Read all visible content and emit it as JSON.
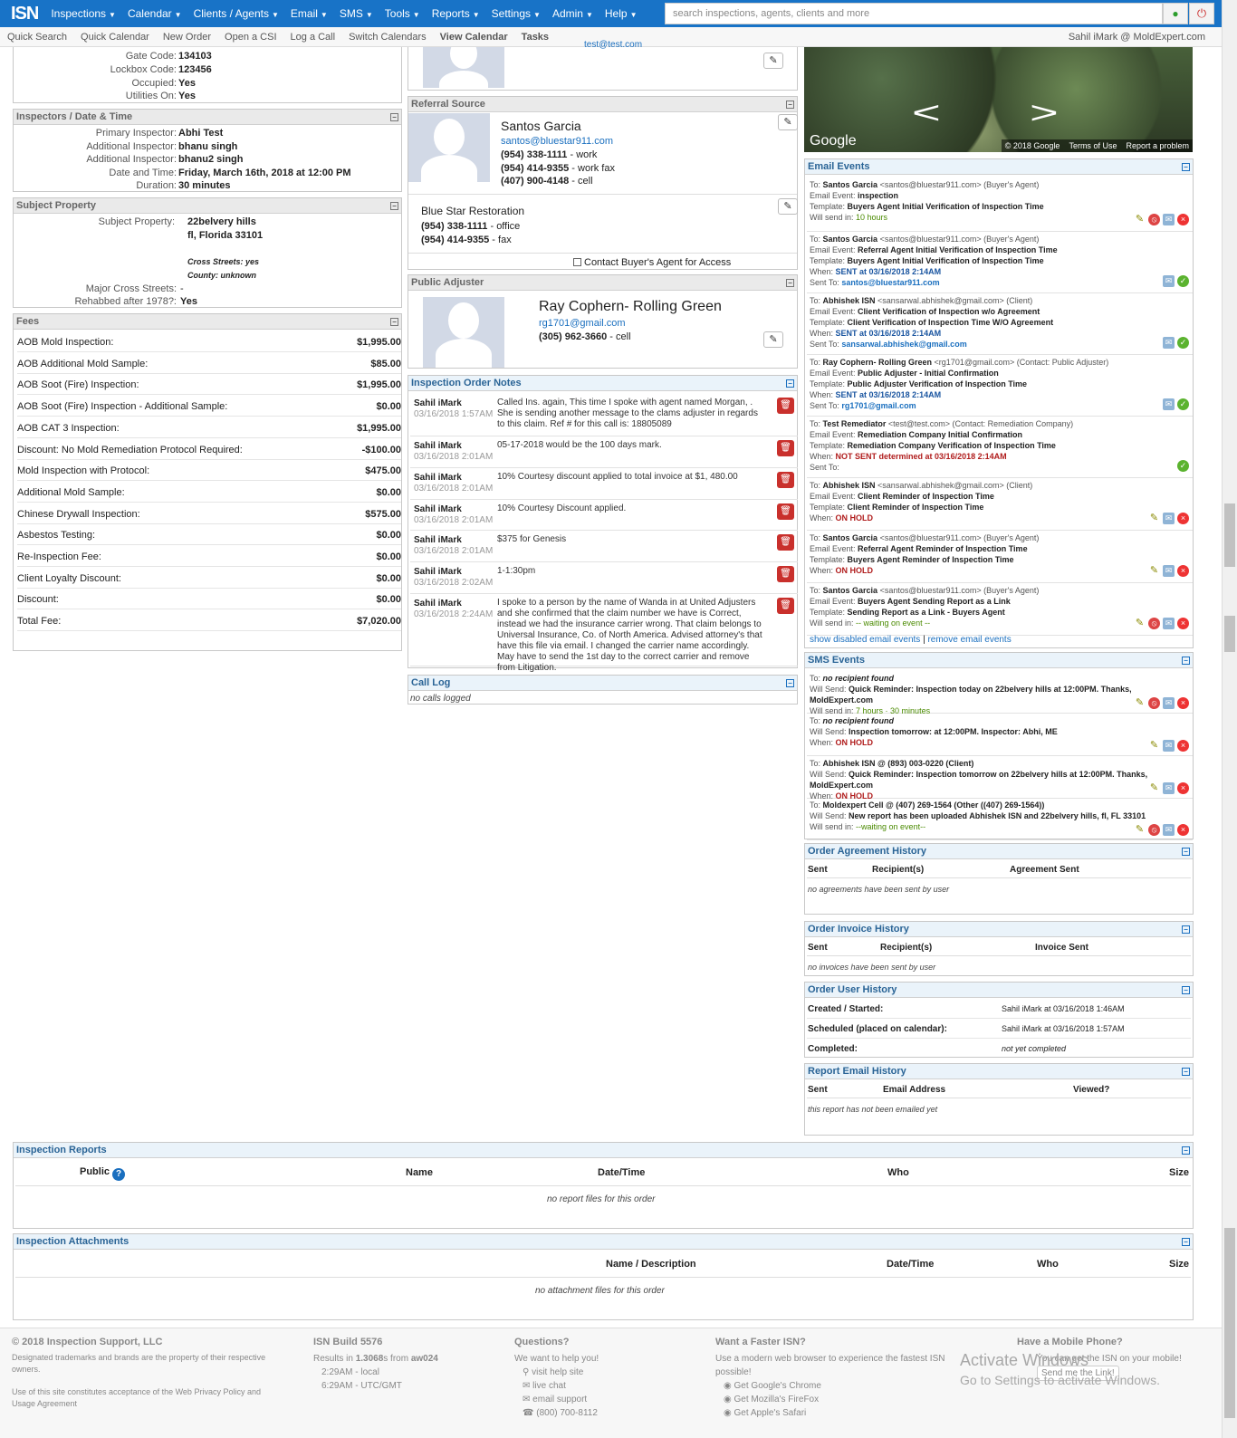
{
  "app": {
    "logo": "ISN"
  },
  "nav": {
    "items": [
      "Inspections",
      "Calendar",
      "Clients / Agents",
      "Email",
      "SMS",
      "Tools",
      "Reports",
      "Settings",
      "Admin",
      "Help"
    ],
    "search_placeholder": "search inspections, agents, clients and more"
  },
  "subnav": {
    "items": [
      "Quick Search",
      "Quick Calendar",
      "New Order",
      "Open a CSI",
      "Log a Call",
      "Switch Calendars",
      "View Calendar",
      "Tasks"
    ],
    "user": "Sahil iMark @ MoldExpert.com"
  },
  "property_top": [
    {
      "label": "Gate Code:",
      "value": "134103"
    },
    {
      "label": "Lockbox Code:",
      "value": "123456"
    },
    {
      "label": "Occupied:",
      "value": "Yes"
    },
    {
      "label": "Utilities On:",
      "value": "Yes"
    }
  ],
  "inspectors": {
    "title": "Inspectors / Date & Time",
    "rows": [
      {
        "label": "Primary Inspector:",
        "value": "Abhi Test"
      },
      {
        "label": "Additional Inspector:",
        "value": "bhanu singh"
      },
      {
        "label": "Additional Inspector:",
        "value": "bhanu2 singh"
      },
      {
        "label": "Date and Time:",
        "value": "Friday, March 16th, 2018 at 12:00 PM"
      },
      {
        "label": "Duration:",
        "value": "30 minutes"
      }
    ]
  },
  "subject": {
    "title": "Subject Property",
    "label": "Subject Property:",
    "line1": "22belvery hills",
    "line2": "fl, Florida 33101",
    "cross": "Cross Streets: yes",
    "county": "County: unknown",
    "major_label": "Major Cross Streets:",
    "major_value": "-",
    "rehab_label": "Rehabbed after 1978?:",
    "rehab_value": "Yes"
  },
  "fees": {
    "title": "Fees",
    "rows": [
      {
        "label": "AOB Mold Inspection:",
        "amount": "$1,995.00"
      },
      {
        "label": "AOB Additional Mold Sample:",
        "amount": "$85.00"
      },
      {
        "label": "AOB Soot (Fire) Inspection:",
        "amount": "$1,995.00"
      },
      {
        "label": "AOB Soot (Fire) Inspection - Additional Sample:",
        "amount": "$0.00"
      },
      {
        "label": "AOB CAT 3 Inspection:",
        "amount": "$1,995.00"
      },
      {
        "label": "Discount: No Mold Remediation Protocol Required:",
        "amount": "-$100.00"
      },
      {
        "label": "Mold Inspection with Protocol:",
        "amount": "$475.00"
      },
      {
        "label": "Additional Mold Sample:",
        "amount": "$0.00"
      },
      {
        "label": "Chinese Drywall Inspection:",
        "amount": "$575.00"
      },
      {
        "label": "Asbestos Testing:",
        "amount": "$0.00"
      },
      {
        "label": "Re-Inspection Fee:",
        "amount": "$0.00"
      },
      {
        "label": "Client Loyalty Discount:",
        "amount": "$0.00"
      },
      {
        "label": "Discount:",
        "amount": "$0.00"
      },
      {
        "label": "Total Fee:",
        "amount": "$7,020.00"
      }
    ]
  },
  "top_contact": {
    "email": "test@test.com"
  },
  "referral": {
    "title": "Referral Source",
    "name": "Santos Garcia",
    "email": "santos@bluestar911.com",
    "phones": [
      {
        "num": "(954) 338-1111",
        "type": "- work"
      },
      {
        "num": "(954) 414-9355",
        "type": "- work fax"
      },
      {
        "num": "(407) 900-4148",
        "type": "- cell"
      }
    ],
    "company": "Blue Star Restoration",
    "cphones": [
      {
        "num": "(954) 338-1111",
        "type": "- office"
      },
      {
        "num": "(954) 414-9355",
        "type": "- fax"
      }
    ],
    "access": "Contact Buyer's Agent for Access"
  },
  "adjuster": {
    "title": "Public Adjuster",
    "name": "Ray Cophern- Rolling Green",
    "email": "rg1701@gmail.com",
    "phone": "(305) 962-3660",
    "phone_type": "- cell"
  },
  "notes": {
    "title": "Inspection Order Notes",
    "items": [
      {
        "who": "Sahil iMark",
        "when": "03/16/2018 1:57AM",
        "text": "Called Ins. again, This time I spoke with agent named Morgan, . She is sending another message to the clams adjuster in regards to this claim. Ref # for this call is: 18805089"
      },
      {
        "who": "Sahil iMark",
        "when": "03/16/2018 2:01AM",
        "text": "05-17-2018 would be the 100 days mark."
      },
      {
        "who": "Sahil iMark",
        "when": "03/16/2018 2:01AM",
        "text": "10% Courtesy discount applied to total invoice at $1, 480.00"
      },
      {
        "who": "Sahil iMark",
        "when": "03/16/2018 2:01AM",
        "text": "10% Courtesy Discount applied."
      },
      {
        "who": "Sahil iMark",
        "when": "03/16/2018 2:01AM",
        "text": "$375 for Genesis"
      },
      {
        "who": "Sahil iMark",
        "when": "03/16/2018 2:02AM",
        "text": "1-1:30pm"
      },
      {
        "who": "Sahil iMark",
        "when": "03/16/2018 2:24AM",
        "text": "I spoke to a person by the name of Wanda in at United Adjusters and she confirmed that the claim number we have is Correct, instead we had the insurance carrier wrong. That claim belongs to Universal Insurance, Co. of North America. Advised attorney's that have this file via email. I changed the carrier name accordingly. May have to send the 1st day to the correct carrier and remove from Litigation."
      }
    ]
  },
  "calllog": {
    "title": "Call Log",
    "empty": "no calls logged"
  },
  "map": {
    "brand": "Google",
    "copyright": "© 2018 Google",
    "terms": "Terms of Use",
    "report": "Report a problem"
  },
  "email_events": {
    "title": "Email Events",
    "items": [
      {
        "to": "Santos Garcia",
        "to_extra": "<santos@bluestar911.com> (Buyer's Agent)",
        "event": "inspection",
        "template": "Buyers Agent Initial Verification of Inspection Time",
        "when_label": "Will send in:",
        "when": "10 hours",
        "sent_to": ""
      },
      {
        "to": "Santos Garcia",
        "to_extra": "<santos@bluestar911.com> (Buyer's Agent)",
        "event": "Referral Agent Initial Verification of Inspection Time",
        "template": "Buyers Agent Initial Verification of Inspection Time",
        "when_label": "When:",
        "when": "SENT at 03/16/2018 2:14AM",
        "sent_to": "santos@bluestar911.com"
      },
      {
        "to": "Abhishek ISN",
        "to_extra": "<sansarwal.abhishek@gmail.com> (Client)",
        "event": "Client Verification of Inspection w/o Agreement",
        "template": "Client Verification of Inspection Time W/O Agreement",
        "when_label": "When:",
        "when": "SENT at 03/16/2018 2:14AM",
        "sent_to": "sansarwal.abhishek@gmail.com"
      },
      {
        "to": "Ray Cophern- Rolling Green",
        "to_extra": "<rg1701@gmail.com> (Contact: Public Adjuster)",
        "event": "Public Adjuster - Initial Confirmation",
        "template": "Public Adjuster Verification of Inspection Time",
        "when_label": "When:",
        "when": "SENT at 03/16/2018 2:14AM",
        "sent_to": "rg1701@gmail.com"
      },
      {
        "to": "Test Remediator",
        "to_extra": "<test@test.com> (Contact: Remediation Company)",
        "event": "Remediation Company Initial Confirmation",
        "template": "Remediation Company Verification of Inspection Time",
        "when_label": "When:",
        "when": "NOT SENT determined at 03/16/2018 2:14AM",
        "sent_to": ""
      },
      {
        "to": "Abhishek ISN",
        "to_extra": "<sansarwal.abhishek@gmail.com> (Client)",
        "event": "Client Reminder of Inspection Time",
        "template": "Client Reminder of Inspection Time",
        "when_label": "When:",
        "when": "ON HOLD",
        "sent_to": ""
      },
      {
        "to": "Santos Garcia",
        "to_extra": "<santos@bluestar911.com> (Buyer's Agent)",
        "event": "Referral Agent Reminder of Inspection Time",
        "template": "Buyers Agent Reminder of Inspection Time",
        "when_label": "When:",
        "when": "ON HOLD",
        "sent_to": ""
      },
      {
        "to": "Santos Garcia",
        "to_extra": "<santos@bluestar911.com> (Buyer's Agent)",
        "event": "Buyers Agent Sending Report as a Link",
        "template": "Sending Report as a Link - Buyers Agent",
        "when_label": "Will send in:",
        "when": "-- waiting on event --",
        "sent_to": ""
      }
    ],
    "link1": "show disabled email events",
    "link2": "remove email events"
  },
  "sms_events": {
    "title": "SMS Events",
    "items": [
      {
        "to": "no recipient found",
        "send": "Quick Reminder: Inspection today on 22belvery hills at 12:00PM. Thanks, MoldExpert.com",
        "when_label": "Will send in:",
        "when": "7 hours · 30 minutes"
      },
      {
        "to": "no recipient found",
        "send": "Inspection tomorrow: at 12:00PM. Inspector: Abhi, ME",
        "when_label": "When:",
        "when": "ON HOLD"
      },
      {
        "to": "Abhishek ISN @ (893) 003-0220 (Client)",
        "send": "Quick Reminder: Inspection tomorrow on 22belvery hills at 12:00PM. Thanks, MoldExpert.com",
        "when_label": "When:",
        "when": "ON HOLD"
      },
      {
        "to": "Moldexpert Cell @ (407) 269-1564 (Other ((407) 269-1564))",
        "send": "New report has been uploaded Abhishek ISN and 22belvery hills, fl, FL 33101",
        "when_label": "Will send in:",
        "when": "--waiting on event--"
      }
    ]
  },
  "agreement": {
    "title": "Order Agreement History",
    "cols": [
      "Sent",
      "Recipient(s)",
      "Agreement Sent"
    ],
    "empty": "no agreements have been sent by user"
  },
  "invoice": {
    "title": "Order Invoice History",
    "cols": [
      "Sent",
      "Recipient(s)",
      "Invoice Sent"
    ],
    "empty": "no invoices have been sent by user"
  },
  "user_history": {
    "title": "Order User History",
    "rows": [
      {
        "label": "Created / Started:",
        "value": "Sahil iMark at 03/16/2018 1:46AM"
      },
      {
        "label": "Scheduled (placed on calendar):",
        "value": "Sahil iMark at 03/16/2018 1:57AM"
      },
      {
        "label": "Completed:",
        "value": "not yet completed"
      }
    ]
  },
  "report_email": {
    "title": "Report Email History",
    "cols": [
      "Sent",
      "Email Address",
      "Viewed?"
    ],
    "empty": "this report has not been emailed yet"
  },
  "reports": {
    "title": "Inspection Reports",
    "cols": [
      "Public",
      "Name",
      "Date/Time",
      "Who",
      "Size"
    ],
    "empty": "no report files for this order"
  },
  "attachments": {
    "title": "Inspection Attachments",
    "cols": [
      "Name / Description",
      "Date/Time",
      "Who",
      "Size"
    ],
    "empty": "no attachment files for this order"
  },
  "footer": {
    "copyright": "© 2018 Inspection Support, LLC",
    "trademark": "Designated trademarks and brands are the property of their respective owners.",
    "terms": "Use of this site constitutes acceptance of the Web Privacy Policy and Usage Agreement",
    "build": "ISN Build 5576",
    "results_pre": "Results in ",
    "results_time": "1.3068",
    "results_mid": "s from ",
    "results_server": "aw024",
    "local": "2:29AM - local",
    "utc": "6:29AM - UTC/GMT",
    "q_title": "Questions?",
    "q_sub": "We want to help you!",
    "q_links": [
      "visit help site",
      "live chat",
      "email support",
      "(800) 700-8112"
    ],
    "f_title": "Want a Faster ISN?",
    "f_sub": "Use a modern web browser to experience the fastest ISN possible!",
    "f_links": [
      "Get Google's Chrome",
      "Get Mozilla's FireFox",
      "Get Apple's Safari"
    ],
    "m_title": "Have a Mobile Phone?",
    "m_sub": "You can get the ISN on your mobile!",
    "m_btn": "Send me the Link!"
  },
  "watermark": {
    "line1": "Activate Windows",
    "line2": "Go to Settings to activate Windows."
  }
}
